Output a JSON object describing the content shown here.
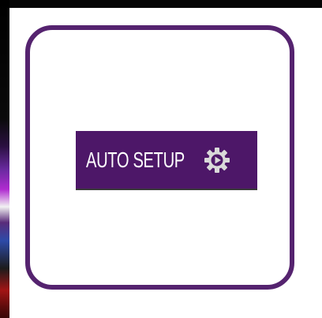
{
  "auto_setup": {
    "label": "AUTO SETUP",
    "icon": "gear-play-icon"
  },
  "colors": {
    "frame_border": "#55236f",
    "button_background": "#4d1768",
    "button_text": "#ffffff",
    "icon_fill": "#d9d9d9"
  }
}
